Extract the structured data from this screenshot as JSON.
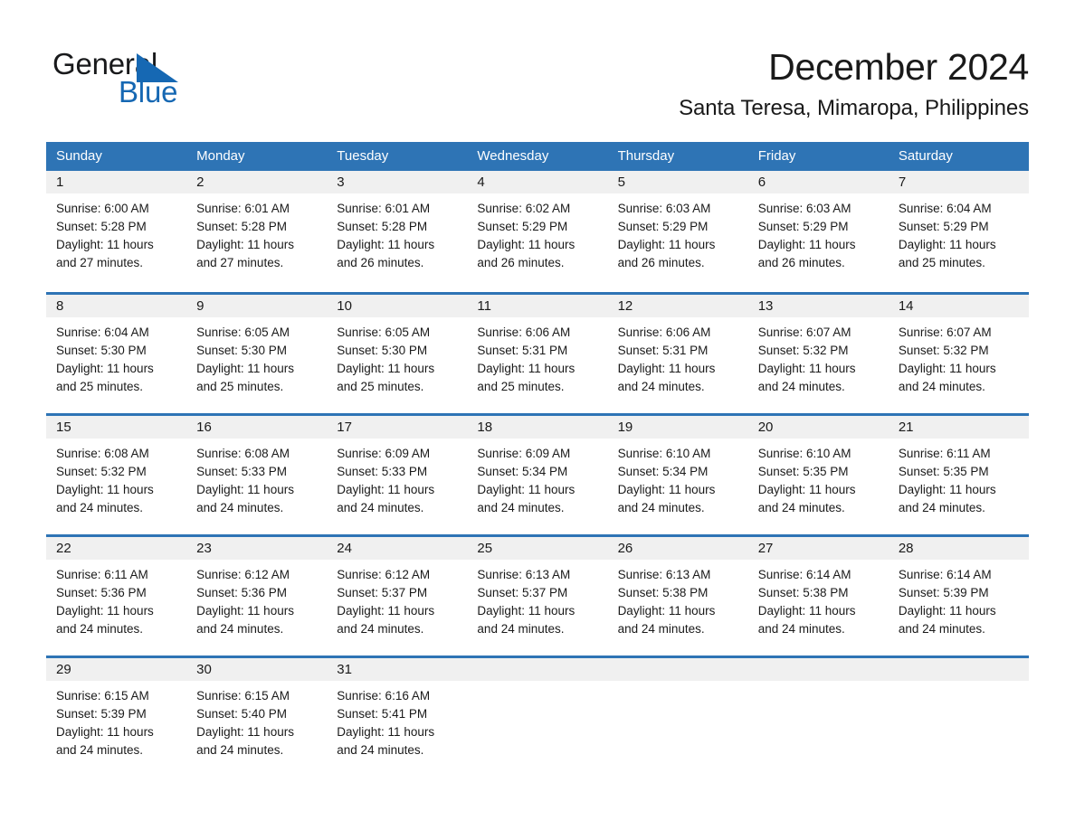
{
  "brand": {
    "name_part1": "General",
    "name_part2": "Blue",
    "triangle_color": "#1668b3",
    "blue_color": "#1668b3"
  },
  "header": {
    "title": "December 2024",
    "subtitle": "Santa Teresa, Mimaropa, Philippines"
  },
  "theme": {
    "header_blue": "#2e74b5",
    "day_band_gray": "#f0f0f0",
    "text_color": "#1a1a1a"
  },
  "weekdays": [
    "Sunday",
    "Monday",
    "Tuesday",
    "Wednesday",
    "Thursday",
    "Friday",
    "Saturday"
  ],
  "weeks": [
    [
      {
        "day": "1",
        "sunrise": "Sunrise: 6:00 AM",
        "sunset": "Sunset: 5:28 PM",
        "daylight": "Daylight: 11 hours and 27 minutes."
      },
      {
        "day": "2",
        "sunrise": "Sunrise: 6:01 AM",
        "sunset": "Sunset: 5:28 PM",
        "daylight": "Daylight: 11 hours and 27 minutes."
      },
      {
        "day": "3",
        "sunrise": "Sunrise: 6:01 AM",
        "sunset": "Sunset: 5:28 PM",
        "daylight": "Daylight: 11 hours and 26 minutes."
      },
      {
        "day": "4",
        "sunrise": "Sunrise: 6:02 AM",
        "sunset": "Sunset: 5:29 PM",
        "daylight": "Daylight: 11 hours and 26 minutes."
      },
      {
        "day": "5",
        "sunrise": "Sunrise: 6:03 AM",
        "sunset": "Sunset: 5:29 PM",
        "daylight": "Daylight: 11 hours and 26 minutes."
      },
      {
        "day": "6",
        "sunrise": "Sunrise: 6:03 AM",
        "sunset": "Sunset: 5:29 PM",
        "daylight": "Daylight: 11 hours and 26 minutes."
      },
      {
        "day": "7",
        "sunrise": "Sunrise: 6:04 AM",
        "sunset": "Sunset: 5:29 PM",
        "daylight": "Daylight: 11 hours and 25 minutes."
      }
    ],
    [
      {
        "day": "8",
        "sunrise": "Sunrise: 6:04 AM",
        "sunset": "Sunset: 5:30 PM",
        "daylight": "Daylight: 11 hours and 25 minutes."
      },
      {
        "day": "9",
        "sunrise": "Sunrise: 6:05 AM",
        "sunset": "Sunset: 5:30 PM",
        "daylight": "Daylight: 11 hours and 25 minutes."
      },
      {
        "day": "10",
        "sunrise": "Sunrise: 6:05 AM",
        "sunset": "Sunset: 5:30 PM",
        "daylight": "Daylight: 11 hours and 25 minutes."
      },
      {
        "day": "11",
        "sunrise": "Sunrise: 6:06 AM",
        "sunset": "Sunset: 5:31 PM",
        "daylight": "Daylight: 11 hours and 25 minutes."
      },
      {
        "day": "12",
        "sunrise": "Sunrise: 6:06 AM",
        "sunset": "Sunset: 5:31 PM",
        "daylight": "Daylight: 11 hours and 24 minutes."
      },
      {
        "day": "13",
        "sunrise": "Sunrise: 6:07 AM",
        "sunset": "Sunset: 5:32 PM",
        "daylight": "Daylight: 11 hours and 24 minutes."
      },
      {
        "day": "14",
        "sunrise": "Sunrise: 6:07 AM",
        "sunset": "Sunset: 5:32 PM",
        "daylight": "Daylight: 11 hours and 24 minutes."
      }
    ],
    [
      {
        "day": "15",
        "sunrise": "Sunrise: 6:08 AM",
        "sunset": "Sunset: 5:32 PM",
        "daylight": "Daylight: 11 hours and 24 minutes."
      },
      {
        "day": "16",
        "sunrise": "Sunrise: 6:08 AM",
        "sunset": "Sunset: 5:33 PM",
        "daylight": "Daylight: 11 hours and 24 minutes."
      },
      {
        "day": "17",
        "sunrise": "Sunrise: 6:09 AM",
        "sunset": "Sunset: 5:33 PM",
        "daylight": "Daylight: 11 hours and 24 minutes."
      },
      {
        "day": "18",
        "sunrise": "Sunrise: 6:09 AM",
        "sunset": "Sunset: 5:34 PM",
        "daylight": "Daylight: 11 hours and 24 minutes."
      },
      {
        "day": "19",
        "sunrise": "Sunrise: 6:10 AM",
        "sunset": "Sunset: 5:34 PM",
        "daylight": "Daylight: 11 hours and 24 minutes."
      },
      {
        "day": "20",
        "sunrise": "Sunrise: 6:10 AM",
        "sunset": "Sunset: 5:35 PM",
        "daylight": "Daylight: 11 hours and 24 minutes."
      },
      {
        "day": "21",
        "sunrise": "Sunrise: 6:11 AM",
        "sunset": "Sunset: 5:35 PM",
        "daylight": "Daylight: 11 hours and 24 minutes."
      }
    ],
    [
      {
        "day": "22",
        "sunrise": "Sunrise: 6:11 AM",
        "sunset": "Sunset: 5:36 PM",
        "daylight": "Daylight: 11 hours and 24 minutes."
      },
      {
        "day": "23",
        "sunrise": "Sunrise: 6:12 AM",
        "sunset": "Sunset: 5:36 PM",
        "daylight": "Daylight: 11 hours and 24 minutes."
      },
      {
        "day": "24",
        "sunrise": "Sunrise: 6:12 AM",
        "sunset": "Sunset: 5:37 PM",
        "daylight": "Daylight: 11 hours and 24 minutes."
      },
      {
        "day": "25",
        "sunrise": "Sunrise: 6:13 AM",
        "sunset": "Sunset: 5:37 PM",
        "daylight": "Daylight: 11 hours and 24 minutes."
      },
      {
        "day": "26",
        "sunrise": "Sunrise: 6:13 AM",
        "sunset": "Sunset: 5:38 PM",
        "daylight": "Daylight: 11 hours and 24 minutes."
      },
      {
        "day": "27",
        "sunrise": "Sunrise: 6:14 AM",
        "sunset": "Sunset: 5:38 PM",
        "daylight": "Daylight: 11 hours and 24 minutes."
      },
      {
        "day": "28",
        "sunrise": "Sunrise: 6:14 AM",
        "sunset": "Sunset: 5:39 PM",
        "daylight": "Daylight: 11 hours and 24 minutes."
      }
    ],
    [
      {
        "day": "29",
        "sunrise": "Sunrise: 6:15 AM",
        "sunset": "Sunset: 5:39 PM",
        "daylight": "Daylight: 11 hours and 24 minutes."
      },
      {
        "day": "30",
        "sunrise": "Sunrise: 6:15 AM",
        "sunset": "Sunset: 5:40 PM",
        "daylight": "Daylight: 11 hours and 24 minutes."
      },
      {
        "day": "31",
        "sunrise": "Sunrise: 6:16 AM",
        "sunset": "Sunset: 5:41 PM",
        "daylight": "Daylight: 11 hours and 24 minutes."
      },
      {
        "day": "",
        "sunrise": "",
        "sunset": "",
        "daylight": ""
      },
      {
        "day": "",
        "sunrise": "",
        "sunset": "",
        "daylight": ""
      },
      {
        "day": "",
        "sunrise": "",
        "sunset": "",
        "daylight": ""
      },
      {
        "day": "",
        "sunrise": "",
        "sunset": "",
        "daylight": ""
      }
    ]
  ]
}
